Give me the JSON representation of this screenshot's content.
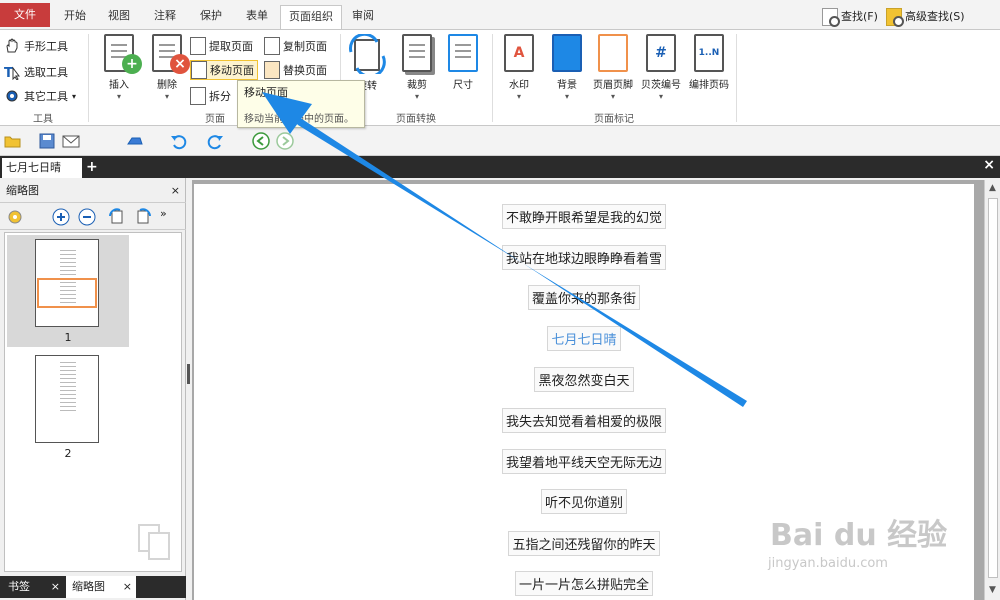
{
  "menu": {
    "file": "文件",
    "tabs": [
      "开始",
      "视图",
      "注释",
      "保护",
      "表单",
      "页面组织",
      "审阅"
    ],
    "active_tab": "页面组织",
    "find": "查找(F)",
    "advanced_find": "高级查找(S)"
  },
  "ribbon": {
    "tools": {
      "hand": "手形工具",
      "select": "选取工具",
      "other": "其它工具",
      "group": "工具"
    },
    "pages": {
      "insert": "插入",
      "delete": "删除",
      "extract": "提取页面",
      "move": "移动页面",
      "split": "拆分",
      "copy": "复制页面",
      "replace": "替换页面",
      "group": "页面"
    },
    "convert": {
      "rotate": "旋转",
      "crop": "裁剪",
      "size": "尺寸",
      "group": "页面转换"
    },
    "marks": {
      "watermark": "水印",
      "background": "背景",
      "header_footer": "页眉页脚",
      "bates": "贝茨编号",
      "numbering": "编排页码",
      "group": "页面标记"
    }
  },
  "tooltip": {
    "title": "移动页面",
    "desc": "移动当前文档中的页面。"
  },
  "doc_tab": {
    "title": "七月七日晴",
    "add": "+",
    "close": "×"
  },
  "left_panel": {
    "title": "缩略图",
    "close": "×",
    "thumbnails": [
      "1",
      "2"
    ],
    "tabs": {
      "bookmarks": "书签",
      "thumbnails": "缩略图",
      "close": "×"
    }
  },
  "document": {
    "lines": [
      "不敢睁开眼希望是我的幻觉",
      "我站在地球边眼睁睁看着雪",
      "覆盖你来的那条街",
      "七月七日晴",
      "黑夜忽然变白天",
      "我失去知觉看着相爱的极限",
      "我望着地平线天空无际无边",
      "听不见你道别",
      "五指之间还残留你的昨天",
      "一片一片怎么拼贴完全"
    ],
    "highlight_index": 3
  },
  "watermark": {
    "brand": "Bai du 经验",
    "url": "jingyan.baidu.com"
  },
  "colors": {
    "file_tab": "#c83c3c",
    "annotation_arrow": "#1e88e5",
    "highlight_text": "#4a90d9",
    "thumb_frame": "#f0914b"
  }
}
